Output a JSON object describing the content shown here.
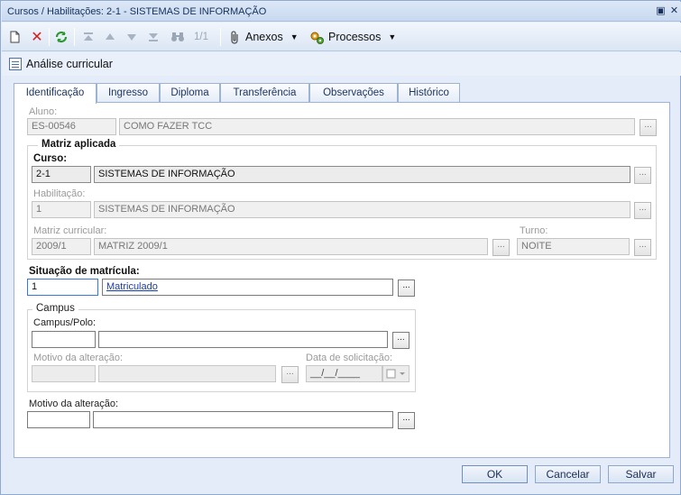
{
  "window": {
    "title": "Cursos / Habilitações: 2-1 - SISTEMAS DE INFORMAÇÃO"
  },
  "toolbar": {
    "paging": "1/1",
    "anexos_label": "Anexos",
    "processos_label": "Processos"
  },
  "section": {
    "title": "Análise curricular"
  },
  "tabs": [
    {
      "label": "Identificação"
    },
    {
      "label": "Ingresso"
    },
    {
      "label": "Diploma"
    },
    {
      "label": "Transferência"
    },
    {
      "label": "Observações"
    },
    {
      "label": "Histórico"
    }
  ],
  "aluno": {
    "label": "Aluno:",
    "code": "ES-00546",
    "name": "COMO FAZER TCC"
  },
  "matriz": {
    "legend": "Matriz aplicada",
    "curso": {
      "label": "Curso:",
      "code": "2-1",
      "name": "SISTEMAS DE INFORMAÇÃO"
    },
    "habilitacao": {
      "label": "Habilitação:",
      "code": "1",
      "name": "SISTEMAS DE INFORMAÇÃO"
    },
    "matriz_curricular": {
      "label": "Matriz curricular:",
      "code": "2009/1",
      "name": "MATRIZ 2009/1"
    },
    "turno": {
      "label": "Turno:",
      "value": "NOITE"
    }
  },
  "situacao": {
    "label": "Situação de matrícula:",
    "code": "1",
    "value": "Matriculado"
  },
  "campus": {
    "legend": "Campus",
    "campus_polo_label": "Campus/Polo:",
    "campus_code": "",
    "campus_name": "",
    "motivo_label": "Motivo da alteração:",
    "motivo_code": "",
    "motivo_name": "",
    "data_label": "Data de solicitação:",
    "data_value": "__/__/____"
  },
  "motivo": {
    "label": "Motivo da alteração:",
    "code": "",
    "name": ""
  },
  "footer": {
    "ok": "OK",
    "cancel": "Cancelar",
    "save": "Salvar"
  },
  "colors": {
    "accent": "#3a78d8",
    "link": "#1a3ca8",
    "title_bg": "#c8d9ef"
  }
}
